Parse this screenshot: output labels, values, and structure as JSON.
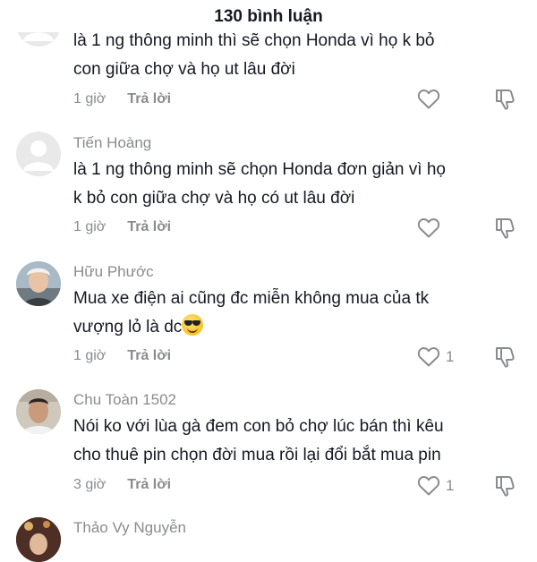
{
  "header": {
    "title": "130 bình luận"
  },
  "comments": [
    {
      "username": "",
      "lines": [
        "là 1 ng thông minh thì sẽ chọn Honda vì họ k bỏ",
        "con giữa chợ và họ ut lâu đời"
      ],
      "time": "1 giờ",
      "reply": "Trả lời",
      "likes": ""
    },
    {
      "username": "Tiến Hoàng",
      "lines": [
        "là 1 ng thông minh sẽ chọn Honda đơn giản vì họ",
        "k bỏ con giữa chợ và họ có ut lâu đời"
      ],
      "time": "1 giờ",
      "reply": "Trả lời",
      "likes": ""
    },
    {
      "username": "Hữu Phước",
      "lines": [
        "Mua xe điện ai cũng đc miễn không mua của tk",
        "vượng lỏ là dc"
      ],
      "time": "1 giờ",
      "reply": "Trả lời",
      "likes": "1"
    },
    {
      "username": "Chu Toàn 1502",
      "lines": [
        "Nói ko với lùa gà đem con bỏ chợ lúc bán thì kêu",
        "cho thuê pin chọn đời mua rồi lại đổi bắt mua pin"
      ],
      "time": "3 giờ",
      "reply": "Trả lời",
      "likes": "1"
    },
    {
      "username": "Thảo Vy Nguyễn",
      "lines": [],
      "time": "",
      "reply": "",
      "likes": ""
    }
  ],
  "icons": {
    "like": "heart-outline-icon",
    "dislike": "thumbs-down-outline-icon",
    "emoji": "smiling-face-with-sunglasses-emoji"
  },
  "colors": {
    "text": "#161823",
    "secondary": "#8a8b91",
    "background": "#ffffff"
  }
}
